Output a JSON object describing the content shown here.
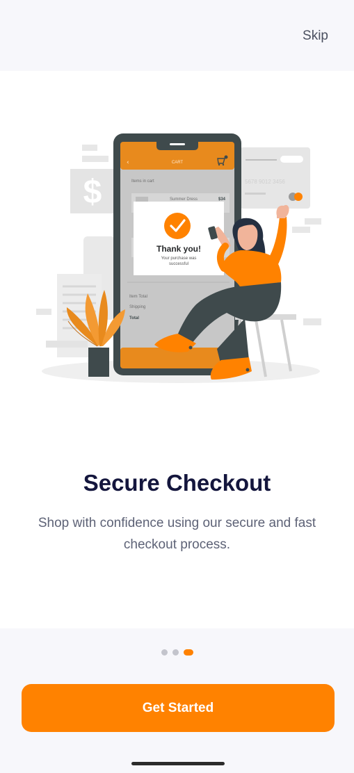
{
  "header": {
    "skip_label": "Skip"
  },
  "illustration": {
    "name": "secure-checkout-illustration",
    "phone": {
      "header": "CART",
      "items_in_cart": "Items in cart",
      "product_name": "Summer Dress",
      "product_price": "$34",
      "item_total": "Item Total",
      "shipping": "Shipping",
      "total": "Total",
      "thank_you": "Thank you!",
      "purchase_msg_line1": "Your purchase was",
      "purchase_msg_line2": "successful"
    },
    "card": {
      "number": "5678 9012 3456"
    },
    "colors": {
      "accent": "#ff8200",
      "slate": "#3f4a4c"
    }
  },
  "main": {
    "title": "Secure Checkout",
    "description": "Shop with confidence using our secure and fast checkout process."
  },
  "pager": {
    "active_index": 2,
    "count": 3
  },
  "cta": {
    "label": "Get Started"
  },
  "colors": {
    "accent": "#ff8200",
    "title": "#14163d",
    "text": "#5d6276",
    "background": "#f7f7fb"
  }
}
